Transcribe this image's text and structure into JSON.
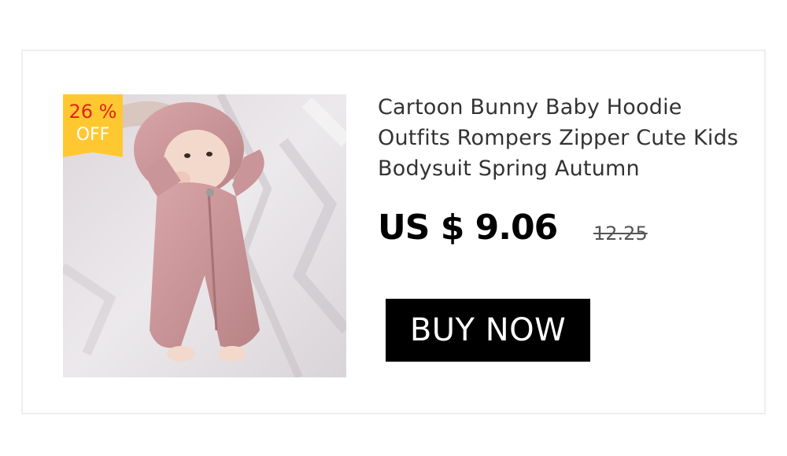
{
  "product": {
    "title": "Cartoon Bunny Baby Hoodie Outfits Rompers Zipper Cute Kids Bodysuit Spring Autumn",
    "price": "US $ 9.06",
    "original_price": "12.25",
    "discount": {
      "percent": "26 %",
      "off_label": "OFF",
      "badge_color": "#ffc830",
      "percent_color": "#e2231a"
    },
    "image_icon": "baby-in-pink-bunny-romper-photo"
  },
  "actions": {
    "buy_label": "BUY NOW",
    "button_color": "#000000"
  }
}
